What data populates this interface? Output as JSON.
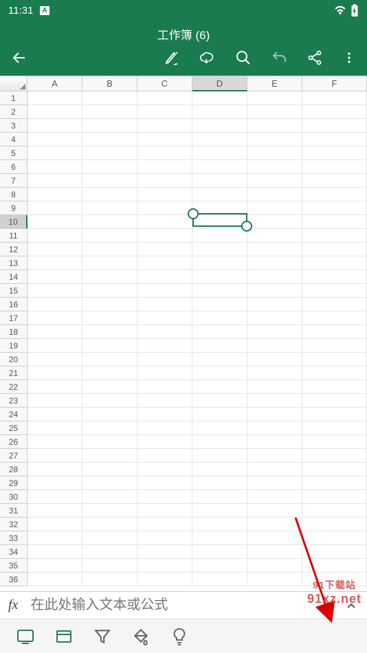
{
  "status_bar": {
    "time": "11:31",
    "indicator": "A"
  },
  "header": {
    "title": "工作簿 (6)"
  },
  "columns": [
    "A",
    "B",
    "C",
    "D",
    "E",
    "F"
  ],
  "row_count": 36,
  "selected_cell": {
    "col": "D",
    "colIndex": 3,
    "row": 10
  },
  "formula_bar": {
    "fx": "fx",
    "placeholder": "在此处输入文本或公式"
  },
  "watermark": {
    "line1": "91下载站",
    "line2": "91xz.net"
  },
  "colors": {
    "primary": "#1a7b4e"
  },
  "icons": {
    "back": "back-icon",
    "pen": "pen-icon",
    "cloud": "cloud-save-icon",
    "search": "search-icon",
    "undo": "undo-icon",
    "share": "share-icon",
    "more": "more-icon",
    "tablet": "tablet-view-icon",
    "card": "card-view-icon",
    "filter": "filter-icon",
    "paint": "paint-bucket-icon",
    "bulb": "lightbulb-icon"
  }
}
